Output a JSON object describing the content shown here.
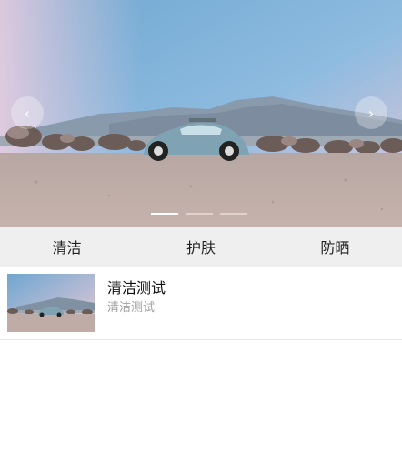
{
  "banner": {
    "prev_icon": "chevron-left-icon",
    "next_icon": "chevron-right-icon",
    "prev_glyph": "‹",
    "next_glyph": "›",
    "slide_count": 3,
    "active_slide": 1
  },
  "tabs": [
    {
      "label": "清洁"
    },
    {
      "label": "护肤"
    },
    {
      "label": "防晒"
    }
  ],
  "list": [
    {
      "title": "清洁测试",
      "subtitle": "清洁测试"
    }
  ]
}
